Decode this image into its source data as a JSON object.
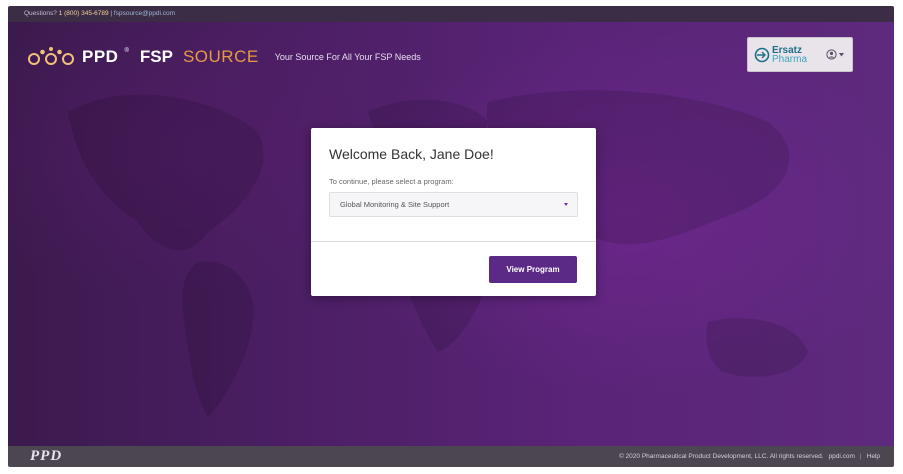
{
  "topbar": {
    "questions": "Questions?",
    "phone": "1 (800) 345-6789",
    "separator": "|",
    "email": "fspsource@ppdi.com"
  },
  "brand": {
    "ppd": "PPD",
    "reg": "®",
    "fsp": "FSP",
    "source": "SOURCE",
    "tagline": "Your Source For All Your FSP Needs"
  },
  "client": {
    "name_line1": "Ersatz",
    "name_line2": "Pharma",
    "user_icon": "user-circle-icon",
    "caret_icon": "chevron-down-icon"
  },
  "modal": {
    "title": "Welcome Back, Jane Doe!",
    "prompt": "To continue, please select a program:",
    "selected_program": "Global Monitoring & Site Support",
    "button": "View Program"
  },
  "footer": {
    "logo": "PPD",
    "copyright": "© 2020 Pharmaceutical Product Development, LLC. All rights reserved.",
    "link1": "ppdi.com",
    "separator": "|",
    "link2": "Help"
  },
  "colors": {
    "brand_purple": "#5b2a86",
    "source_orange": "#e59b43",
    "caret_purple": "#7a2e9a"
  }
}
